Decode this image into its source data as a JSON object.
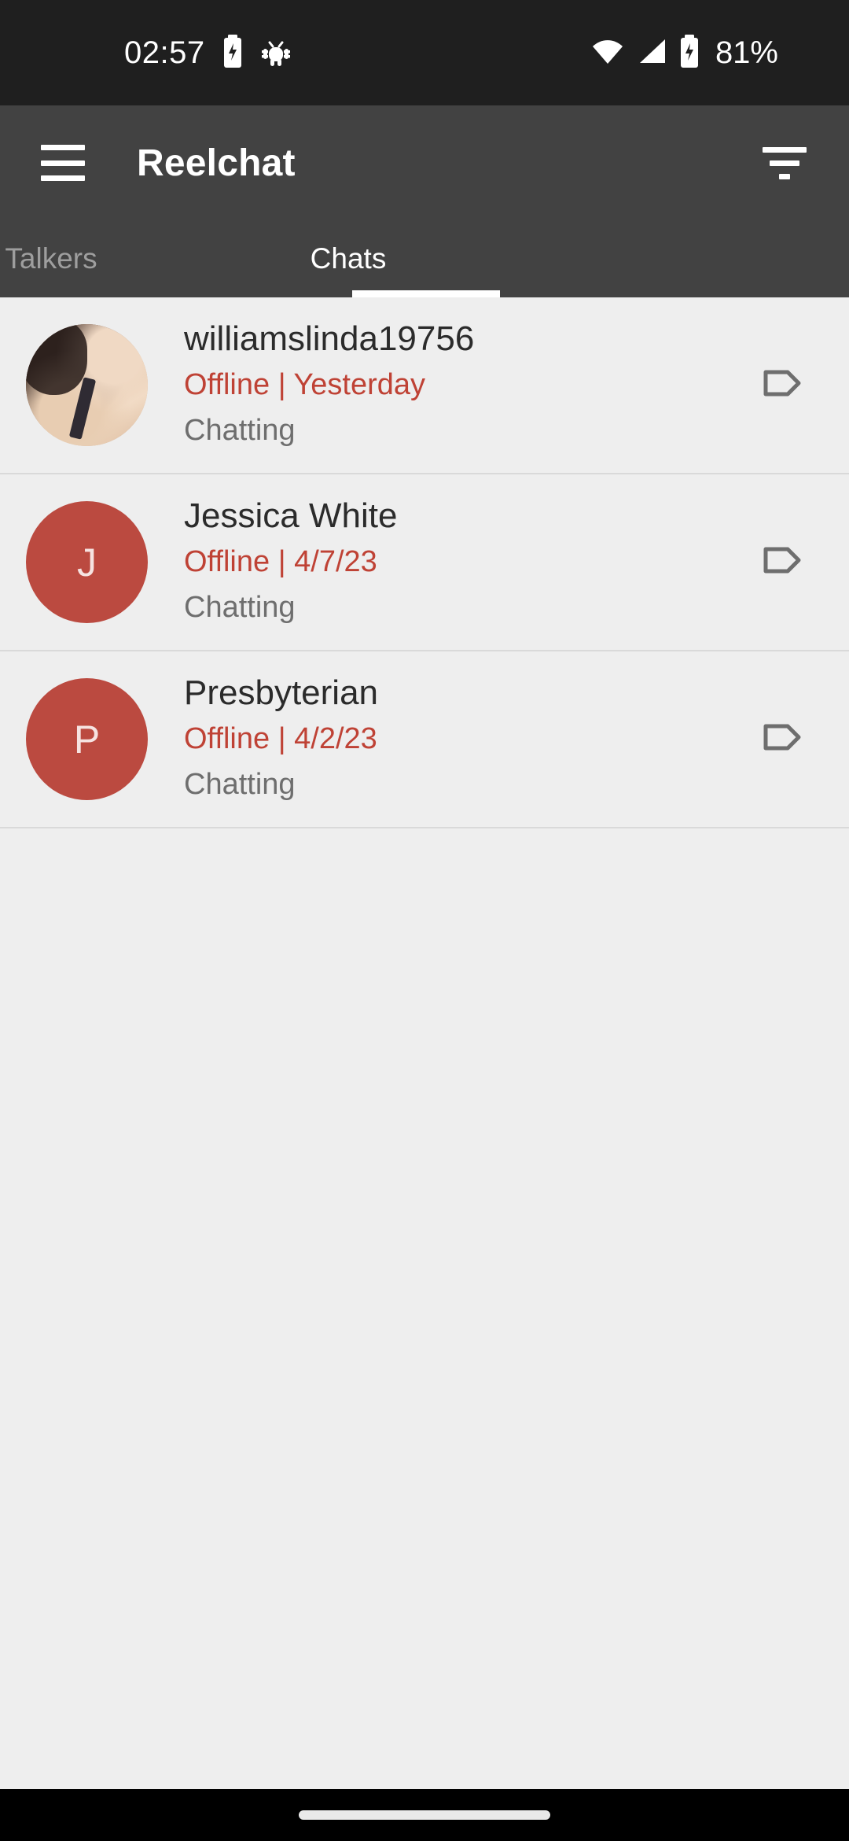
{
  "status_bar": {
    "time": "02:57",
    "battery_percent": "81%",
    "icons": {
      "charging": "battery-charging-icon",
      "bug": "android-bug-icon",
      "wifi": "wifi-icon",
      "signal": "cellular-signal-icon",
      "battery": "battery-icon"
    },
    "background_color": "#1f1f1f"
  },
  "app_bar": {
    "title": "Reelchat",
    "menu_icon": "hamburger-menu-icon",
    "filter_icon": "filter-icon",
    "background_color": "#424242"
  },
  "tabs": {
    "items": [
      {
        "label": "Talkers",
        "active": false
      },
      {
        "label": "Chats",
        "active": true
      }
    ],
    "active_index": 1,
    "indicator_color": "#ffffff",
    "inactive_color": "#9e9e9e"
  },
  "chat_list": {
    "background_color": "#eeeeee",
    "status_color": "#bf4235",
    "avatar_color": "#bb4a40",
    "rows": [
      {
        "name": "williamslinda19756",
        "status": "Offline | Yesterday",
        "sub": "Chatting",
        "avatar_type": "photo",
        "avatar_letter": "",
        "tag_icon": "label-tag-icon"
      },
      {
        "name": "Jessica White",
        "status": "Offline | 4/7/23",
        "sub": "Chatting",
        "avatar_type": "letter",
        "avatar_letter": "J",
        "tag_icon": "label-tag-icon"
      },
      {
        "name": "Presbyterian",
        "status": "Offline | 4/2/23",
        "sub": "Chatting",
        "avatar_type": "letter",
        "avatar_letter": "P",
        "tag_icon": "label-tag-icon"
      }
    ]
  },
  "nav_bar": {
    "gesture_handle": "gesture-pill",
    "background_color": "#000000"
  }
}
